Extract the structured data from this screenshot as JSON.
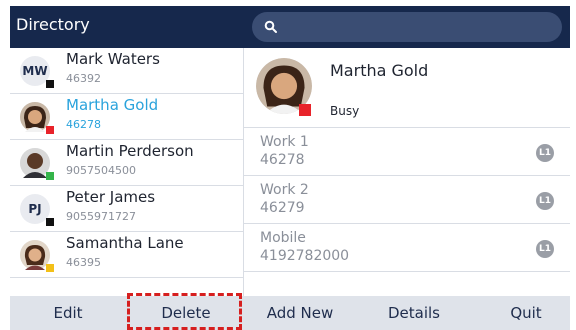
{
  "header": {
    "title": "Directory"
  },
  "search": {
    "icon": "search-icon"
  },
  "colors": {
    "header_bg": "#16284c",
    "accent": "#2aa3dc",
    "busy": "#e8232a",
    "available": "#34b44a",
    "away": "#f3c018",
    "offline": "#111111",
    "softkey_bg": "#dfe3ea",
    "highlight": "#d61f1f"
  },
  "contacts": [
    {
      "name": "Mark Waters",
      "number": "46392",
      "initials": "MW",
      "status": "offline",
      "selected": false
    },
    {
      "name": "Martha Gold",
      "number": "46278",
      "initials": "",
      "status": "busy",
      "selected": true
    },
    {
      "name": "Martin Perderson",
      "number": "9057504500",
      "initials": "",
      "status": "available",
      "selected": false
    },
    {
      "name": "Peter James",
      "number": "9055971727",
      "initials": "PJ",
      "status": "offline",
      "selected": false
    },
    {
      "name": "Samantha Lane",
      "number": "46395",
      "initials": "",
      "status": "away",
      "selected": false
    }
  ],
  "detail": {
    "name": "Martha Gold",
    "status": "Busy",
    "entries": [
      {
        "label": "Work 1",
        "value": "46278",
        "line": "L1"
      },
      {
        "label": "Work 2",
        "value": "46279",
        "line": "L1"
      },
      {
        "label": "Mobile",
        "value": "4192782000",
        "line": "L1"
      }
    ]
  },
  "softkeys": {
    "edit": "Edit",
    "delete": "Delete",
    "add_new": "Add New",
    "details": "Details",
    "quit": "Quit"
  }
}
